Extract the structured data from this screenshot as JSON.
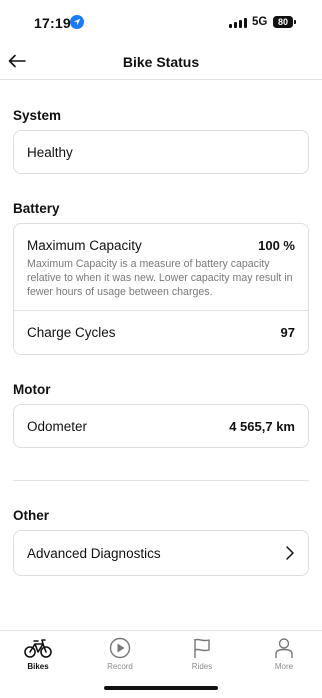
{
  "status_bar": {
    "time": "17:19",
    "network": "5G",
    "battery": "80"
  },
  "header": {
    "title": "Bike Status"
  },
  "system": {
    "title": "System",
    "value": "Healthy"
  },
  "battery": {
    "title": "Battery",
    "max_capacity_label": "Maximum Capacity",
    "max_capacity_value": "100 %",
    "max_capacity_desc": "Maximum Capacity is a measure of battery capacity relative to when it was new. Lower capacity may result in fewer hours of usage between charges.",
    "charge_cycles_label": "Charge Cycles",
    "charge_cycles_value": "97"
  },
  "motor": {
    "title": "Motor",
    "odometer_label": "Odometer",
    "odometer_value": "4 565,7 km"
  },
  "other": {
    "title": "Other",
    "advanced_label": "Advanced Diagnostics"
  },
  "tabs": [
    {
      "label": "Bikes",
      "icon": "bike-icon",
      "active": true
    },
    {
      "label": "Record",
      "icon": "play-icon",
      "active": false
    },
    {
      "label": "Rides",
      "icon": "flag-icon",
      "active": false
    },
    {
      "label": "More",
      "icon": "person-icon",
      "active": false
    }
  ]
}
